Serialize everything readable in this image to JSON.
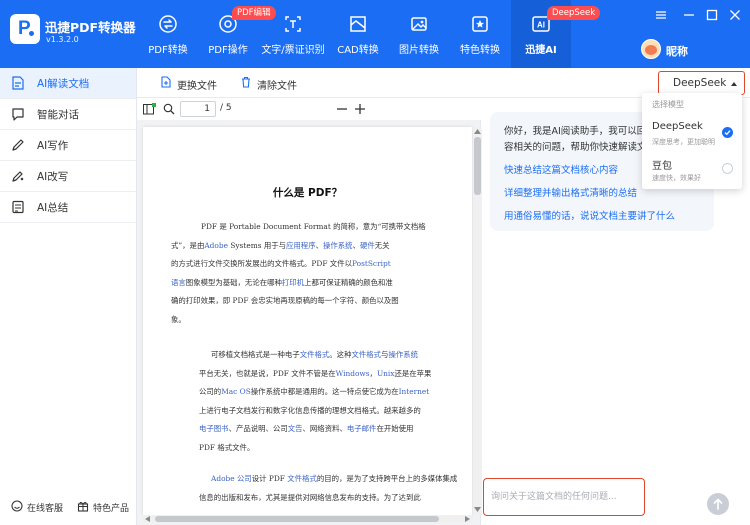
{
  "app": {
    "name": "迅捷PDF转换器",
    "version": "v1.3.2.0"
  },
  "colors": {
    "brand": "#1b6ef3",
    "brand_active": "#1560d8",
    "badge": "#ff4d4f",
    "highlight_border": "#e0462a"
  },
  "nav": {
    "items": [
      {
        "label": "PDF转换",
        "icon": "pdf-convert-icon"
      },
      {
        "label": "PDF操作",
        "icon": "pdf-operate-icon",
        "badge": "PDF编辑"
      },
      {
        "label": "文字/票证识别",
        "icon": "ocr-icon"
      },
      {
        "label": "CAD转换",
        "icon": "cad-icon"
      },
      {
        "label": "图片转换",
        "icon": "image-icon"
      },
      {
        "label": "特色转换",
        "icon": "star-icon"
      },
      {
        "label": "迅捷AI",
        "icon": "ai-icon",
        "badge": "DeepSeek",
        "active": true
      }
    ]
  },
  "user": {
    "nickname": "昵称"
  },
  "sidebar": {
    "items": [
      {
        "label": "AI解读文档",
        "icon": "document-ai-icon",
        "active": true
      },
      {
        "label": "智能对话",
        "icon": "chat-icon"
      },
      {
        "label": "AI写作",
        "icon": "pen-icon"
      },
      {
        "label": "AI改写",
        "icon": "rewrite-icon"
      },
      {
        "label": "AI总结",
        "icon": "summary-icon"
      }
    ],
    "footer": {
      "service": "在线客服",
      "features": "特色产品"
    }
  },
  "doc_toolbar": {
    "change_file": "更换文件",
    "clear_file": "清除文件"
  },
  "model": {
    "selected": "DeepSeek",
    "dropdown_title": "选择模型",
    "options": [
      {
        "name": "DeepSeek",
        "desc": "深度思考，更加聪明",
        "selected": true
      },
      {
        "name": "豆包",
        "desc": "速度快，效果好",
        "selected": false
      }
    ]
  },
  "viewer": {
    "page": "1",
    "total": "/ 5"
  },
  "document": {
    "title": "什么是 PDF？",
    "p1": [
      "PDF 是 Portable Document Format 的简称，意为“可携带文档格",
      "式”，是由",
      "Adobe",
      " Systems 用于与",
      "应用程序",
      "、",
      "操作系统",
      "、",
      "硬件",
      "无关",
      "的方式进行文件交换所发展出的文件格式。PDF 文件以",
      "PostScript",
      "语言",
      "图象模型为基础，无论在哪种",
      "打印机",
      "上都可保证精确的颜色和准",
      "确的打印效果，即 PDF 会忠实地再现原稿的每一个字符、颜色以及图",
      "象。"
    ],
    "p2": [
      "可移植文档格式是一种电子",
      "文件格式",
      "。这种",
      "文件格式",
      "与",
      "操作系统",
      "平台无关，也就是说，PDF 文件不管是在",
      "Windows",
      "，",
      "Unix",
      "还是在苹果",
      "公司的",
      "Mac OS",
      "操作系统中都是通用的。这一特点使它成为在",
      "Internet",
      "上进行电子文档发行和数字化信息传播的理想文档格式。越来越多的",
      "电子图书",
      "、产品说明、公司",
      "文告",
      "、网络资料、",
      "电子邮件",
      "在开始使用",
      "PDF 格式文件。"
    ],
    "p3": [
      "Adobe",
      " 公司",
      "设计 PDF ",
      "文件格式",
      "的目的，是为了支持跨平台上的多媒体集成",
      "信息的出版和发布，尤其是提供对网络信息发布的支持。为了达到此"
    ]
  },
  "chat": {
    "greeting_lines": [
      "你好，我是AI阅读助手，我可以回",
      "容相关的问题，帮助你快速解读文"
    ],
    "suggestions": [
      "快速总结这篇文档核心内容",
      "详细整理并输出格式清晰的总结",
      "用通俗易懂的话，说说文档主要讲了什么"
    ],
    "input_placeholder": "询问关于这篇文档的任何问题..."
  }
}
